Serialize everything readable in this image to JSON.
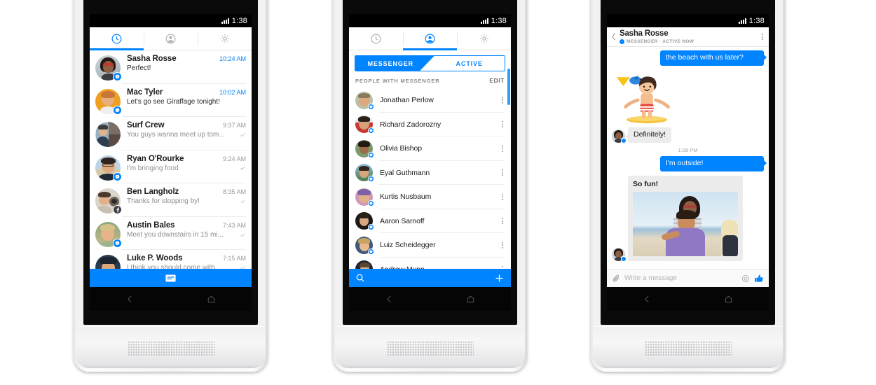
{
  "status_bar": {
    "time": "1:38",
    "signal_icon": "signal-bars-icon"
  },
  "colors": {
    "messenger_blue": "#0084ff",
    "bubble_incoming": "#ececec",
    "text_primary": "#1b1b1b",
    "text_secondary": "#8e8e8e"
  },
  "phone1": {
    "tabs": [
      {
        "id": "recent",
        "icon": "clock-icon",
        "active": true
      },
      {
        "id": "people",
        "icon": "person-icon",
        "active": false
      },
      {
        "id": "settings",
        "icon": "gear-icon",
        "active": false
      }
    ],
    "threads": [
      {
        "name": "Sasha Rosse",
        "preview": "Perfect!",
        "time": "10:24 AM",
        "unread": true,
        "badge": "messenger",
        "state": "none"
      },
      {
        "name": "Mac Tyler",
        "preview": "Let's go see Giraffage tonight!",
        "time": "10:02 AM",
        "unread": true,
        "badge": "messenger",
        "state": "none"
      },
      {
        "name": "Surf Crew",
        "preview": "You guys wanna meet up tom...",
        "time": "9:37 AM",
        "unread": false,
        "badge": "none",
        "state": "check"
      },
      {
        "name": "Ryan O'Rourke",
        "preview": "I'm bringing food",
        "time": "9:24 AM",
        "unread": false,
        "badge": "messenger",
        "state": "reply"
      },
      {
        "name": "Ben Langholz",
        "preview": "Thanks for stopping by!",
        "time": "8:35 AM",
        "unread": false,
        "badge": "facebook",
        "state": "check"
      },
      {
        "name": "Austin Bales",
        "preview": "Meet you downstairs in 15 mi...",
        "time": "7:43 AM",
        "unread": false,
        "badge": "messenger",
        "state": "check"
      },
      {
        "name": "Luke P. Woods",
        "preview": "I think you should come with...",
        "time": "7:15 AM",
        "unread": false,
        "badge": "messenger",
        "state": "check"
      }
    ],
    "compose_button": {
      "icon": "new-message-icon"
    },
    "nav": {
      "back": "back-icon",
      "home": "home-icon"
    }
  },
  "phone2": {
    "tabs": [
      {
        "id": "recent",
        "icon": "clock-icon",
        "active": false
      },
      {
        "id": "people",
        "icon": "person-icon",
        "active": true
      },
      {
        "id": "settings",
        "icon": "gear-icon",
        "active": false
      }
    ],
    "segmented": {
      "left_label": "MESSENGER",
      "right_label": "ACTIVE",
      "selected": "MESSENGER"
    },
    "section": {
      "title": "PEOPLE WITH MESSENGER",
      "action": "EDIT"
    },
    "people": [
      {
        "name": "Jonathan Perlow",
        "badge": "messenger"
      },
      {
        "name": "Richard Zadorozny",
        "badge": "messenger"
      },
      {
        "name": "Olivia Bishop",
        "badge": "messenger"
      },
      {
        "name": "Eyal Guthmann",
        "badge": "messenger"
      },
      {
        "name": "Kurtis Nusbaum",
        "badge": "messenger"
      },
      {
        "name": "Aaron Sarnoff",
        "badge": "messenger"
      },
      {
        "name": "Luiz Scheidegger",
        "badge": "messenger"
      },
      {
        "name": "Andrew Munn",
        "badge": "messenger"
      }
    ],
    "bottom_bar": {
      "search_icon": "search-icon",
      "add_icon": "plus-icon"
    },
    "nav": {
      "back": "back-icon",
      "home": "home-icon"
    }
  },
  "phone3": {
    "header": {
      "back_icon": "chevron-left-icon",
      "title": "Sasha Rosse",
      "status_badge_icon": "messenger-badge-icon",
      "status": "MESSENGER · ACTIVE NOW",
      "overflow_icon": "overflow-menu-icon"
    },
    "messages": [
      {
        "type": "text",
        "dir": "out",
        "text": "the beach with us later?"
      },
      {
        "type": "sticker",
        "dir": "in",
        "sticker": "surfer-sticker"
      },
      {
        "type": "text",
        "dir": "in",
        "text": "Definitely!",
        "avatar": true
      },
      {
        "type": "time",
        "text": "1:38 PM"
      },
      {
        "type": "text",
        "dir": "out",
        "text": "I'm outside!"
      },
      {
        "type": "photo",
        "dir": "in",
        "caption": "So fun!",
        "image": "beach-piggyback-photo",
        "avatar": true
      }
    ],
    "composer": {
      "attach_icon": "paperclip-icon",
      "placeholder": "Write a message",
      "emoji_icon": "smiley-icon",
      "like_icon": "thumbs-up-icon"
    },
    "nav": {
      "back": "back-icon",
      "home": "home-icon"
    }
  }
}
